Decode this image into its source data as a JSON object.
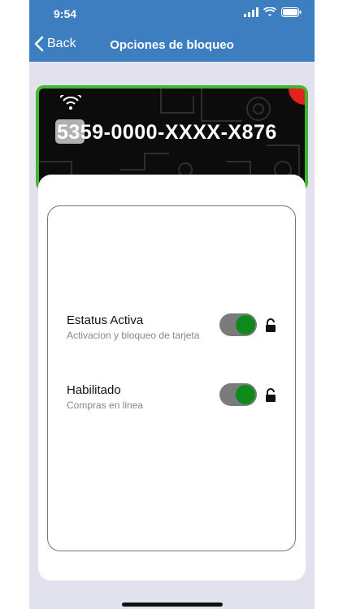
{
  "status_bar": {
    "time": "9:54"
  },
  "nav": {
    "back_label": "Back",
    "title": "Opciones de bloqueo"
  },
  "card": {
    "number": "5359-0000-XXXX-X876"
  },
  "options": [
    {
      "title": "Estatus Activa",
      "subtitle": "Activacion y bloqueo de tarjeta",
      "enabled": true
    },
    {
      "title": "Habilitado",
      "subtitle": "Compras en linea",
      "enabled": true
    }
  ],
  "colors": {
    "nav_bg": "#3d7ec0",
    "card_border": "#42b62f",
    "toggle_on": "#0e8a1c",
    "page_bg": "#e2e1ee"
  }
}
